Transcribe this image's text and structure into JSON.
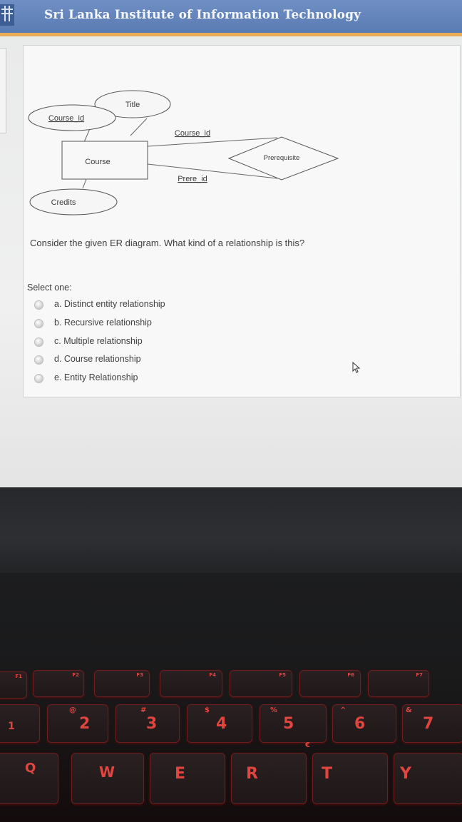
{
  "header": {
    "title": "Sri Lanka Institute of Information Technology"
  },
  "er": {
    "entity": "Course",
    "attr_title": "Title",
    "attr_course_id": "Course_id",
    "attr_credits": "Credits",
    "relationship": "Prerequisite",
    "role_top": "Course_id",
    "role_bottom": "Prere_id"
  },
  "question": {
    "text": "Consider the given ER diagram. What kind of a relationship is this?",
    "select_label": "Select one:",
    "options": [
      "a. Distinct entity relationship",
      "b. Recursive relationship",
      "c. Multiple relationship",
      "d. Course relationship",
      "e. Entity Relationship"
    ]
  },
  "keyboard": {
    "fn_row": [
      "F1",
      "F2",
      "F3",
      "F4",
      "F5",
      "F6",
      "F7"
    ],
    "num_row": [
      "1",
      "2",
      "3",
      "4",
      "5",
      "6",
      "7"
    ],
    "symbols": [
      "@",
      "#",
      "$",
      "%",
      "^",
      "&",
      "€"
    ],
    "letters": [
      "Q",
      "W",
      "E",
      "R",
      "T",
      "Y"
    ]
  },
  "colors": {
    "header": "#5a7bb3",
    "stripe": "#e8ad56",
    "key_glow": "#e0453f"
  }
}
